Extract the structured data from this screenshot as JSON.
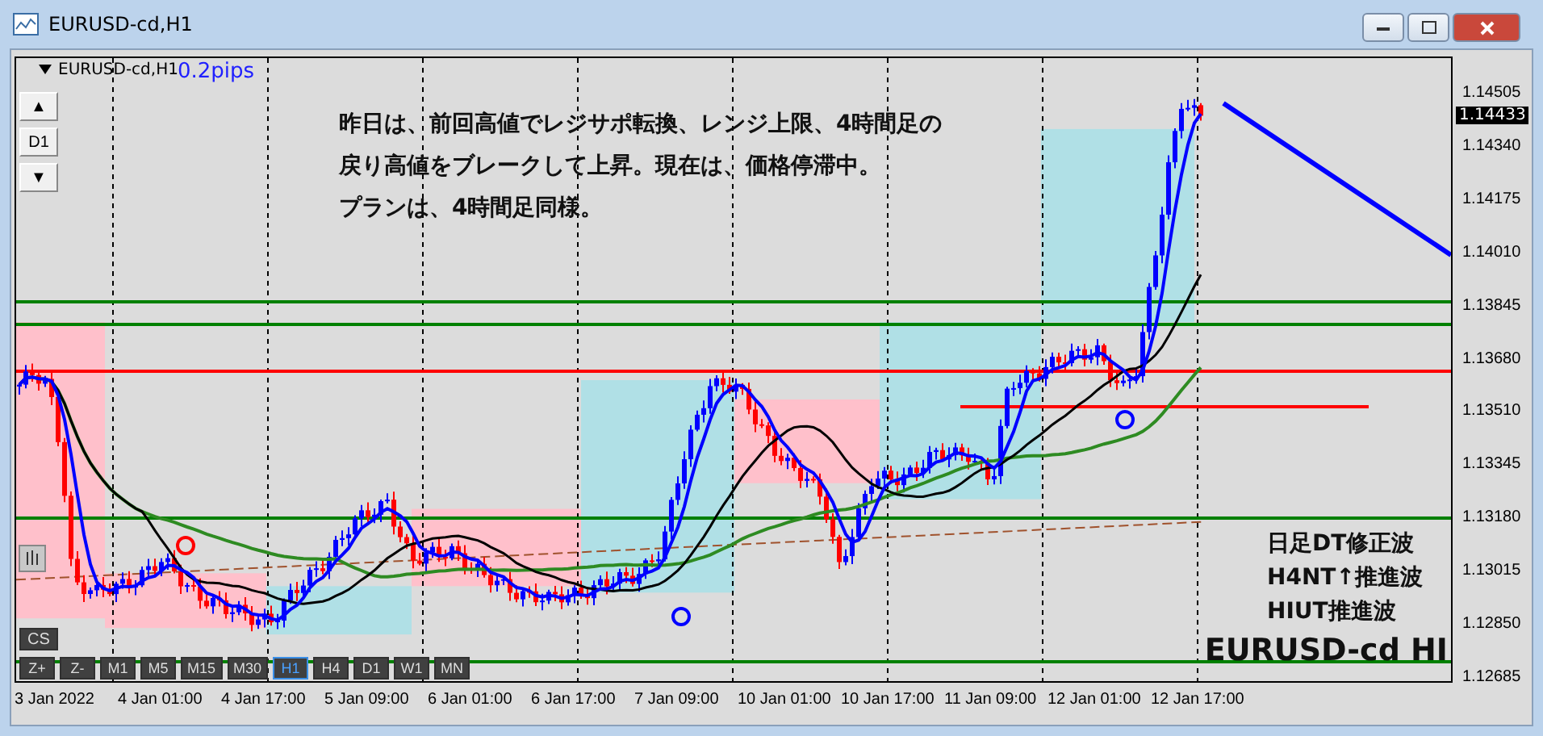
{
  "window": {
    "title": "EURUSD-cd,H1"
  },
  "chart": {
    "symbol_label": "EURUSD-cd,H1",
    "spread": "0.2pips",
    "side_buttons": [
      "▲",
      "D1",
      "▼"
    ],
    "notes": [
      "昨日は、前回高値でレジサポ転換、レンジ上限、4時間足の",
      "戻り高値をブレークして上昇。現在は、価格停滞中。",
      "プランは、4時間足同様。"
    ],
    "wave_notes": [
      "日足DT修正波",
      "H4NT↑推進波",
      "HIUT推進波"
    ],
    "symbol_caption": "EURUSD-cd HI",
    "cs_button": "CS",
    "toolbar": [
      {
        "label": "Z+",
        "selected": false
      },
      {
        "label": "Z-",
        "selected": false
      },
      {
        "label": "M1",
        "selected": false
      },
      {
        "label": "M5",
        "selected": false
      },
      {
        "label": "M15",
        "selected": false
      },
      {
        "label": "M30",
        "selected": false
      },
      {
        "label": "H1",
        "selected": true
      },
      {
        "label": "H4",
        "selected": false
      },
      {
        "label": "D1",
        "selected": false
      },
      {
        "label": "W1",
        "selected": false
      },
      {
        "label": "MN",
        "selected": false
      }
    ]
  },
  "price_axis": {
    "ticks": [
      "1.14505",
      "1.14340",
      "1.14175",
      "1.14010",
      "1.13845",
      "1.13680",
      "1.13510",
      "1.13345",
      "1.13180",
      "1.13015",
      "1.12850",
      "1.12685"
    ],
    "current_price": "1.14433"
  },
  "time_axis": {
    "ticks": [
      "3 Jan 2022",
      "4 Jan 01:00",
      "4 Jan 17:00",
      "5 Jan 09:00",
      "6 Jan 01:00",
      "6 Jan 17:00",
      "7 Jan 09:00",
      "10 Jan 01:00",
      "10 Jan 17:00",
      "11 Jan 09:00",
      "12 Jan 01:00",
      "12 Jan 17:00"
    ]
  }
}
